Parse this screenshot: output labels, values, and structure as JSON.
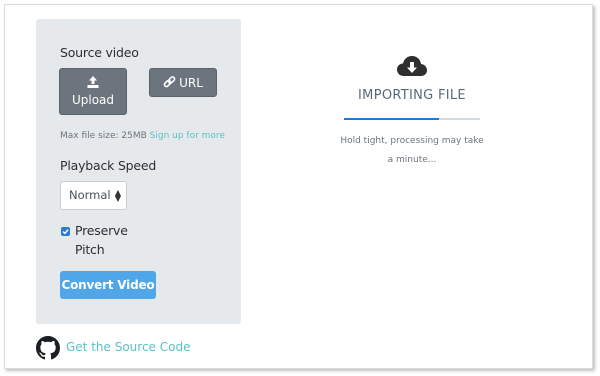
{
  "source": {
    "heading": "Source video",
    "upload_label": "Upload",
    "url_label": "URL",
    "max_size_text": "Max file size: 25MB",
    "signup_link": "Sign up for more"
  },
  "playback": {
    "heading": "Playback Speed",
    "selected_value": "Normal",
    "preserve_pitch_line1": "Preserve",
    "preserve_pitch_line2": "Pitch",
    "preserve_pitch_checked": true
  },
  "convert_label": "Convert Video",
  "status": {
    "title": "IMPORTING FILE",
    "message_line1": "Hold tight, processing may take",
    "message_line2": "a minute...",
    "progress": 0.7
  },
  "footer": {
    "source_link": "Get the Source Code"
  },
  "colors": {
    "accent": "#4fa6e8",
    "link": "#5bc0c8",
    "progress": "#1e7bd4"
  },
  "icons": {
    "upload": "upload-icon",
    "url": "link-icon",
    "status": "cloud-download-icon",
    "footer": "github-icon"
  }
}
